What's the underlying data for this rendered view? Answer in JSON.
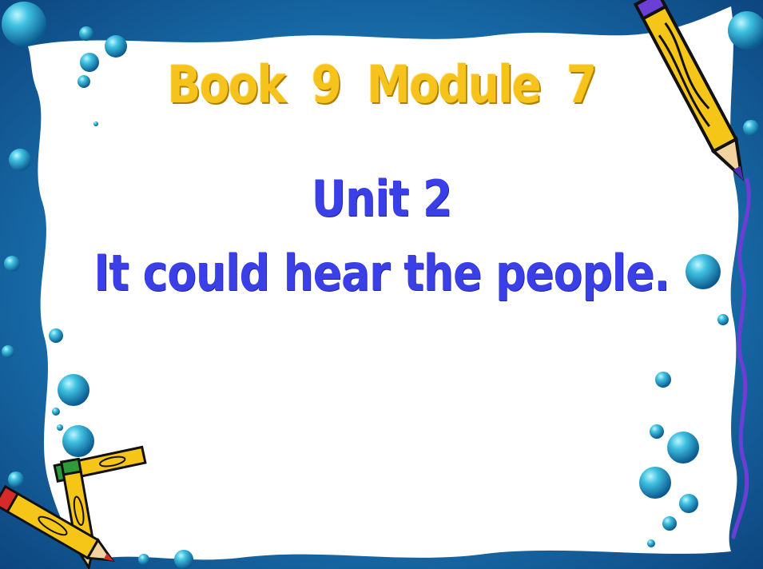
{
  "slide": {
    "book_title": "Book 9  Module 7",
    "unit_title": "Unit 2",
    "lesson_title": "It could hear the people."
  },
  "colors": {
    "background_blue": "#1a6fa8",
    "paper": "#ffffff",
    "title_gold": "#f6c21c",
    "text_blue": "#3a3fe6",
    "pencil_yellow": "#f5c518",
    "scribble_purple": "#6b3fd6"
  },
  "icons": [
    "bubble-icon",
    "pencil-icon",
    "crossed-pencils-icon",
    "scribble-line-icon"
  ]
}
